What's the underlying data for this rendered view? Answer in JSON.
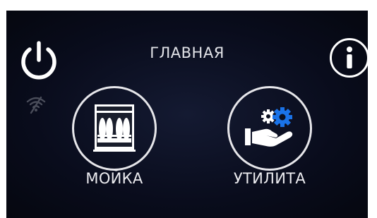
{
  "header": {
    "title": "ГЛАВНАЯ",
    "power_icon": "power-icon",
    "wifi_icon": "wifi-off-icon",
    "info_icon": "info-icon"
  },
  "main": {
    "buttons": [
      {
        "label": "МОЙКА",
        "icon": "dishwasher-icon"
      },
      {
        "label": "УТИЛИТА",
        "icon": "hand-gears-icon"
      }
    ]
  },
  "colors": {
    "background": "#090c1c",
    "foreground": "#ececf0",
    "gear_small": "#ffffff",
    "gear_large": "#1a73e8"
  }
}
